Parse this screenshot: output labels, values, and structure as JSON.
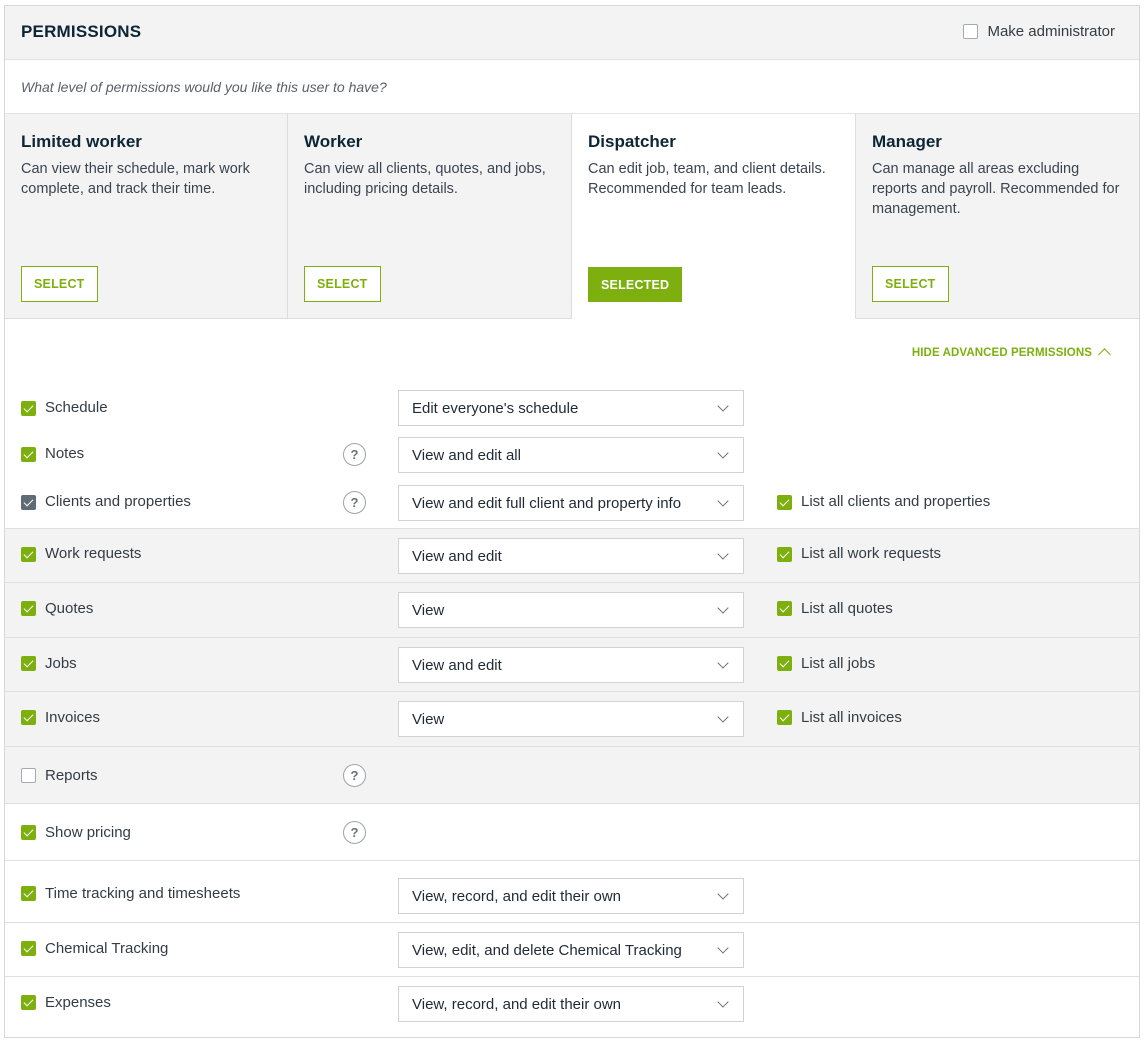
{
  "header": {
    "title": "PERMISSIONS",
    "admin_label": "Make administrator"
  },
  "question": "What level of permissions would you like this user to have?",
  "roles": [
    {
      "name": "Limited worker",
      "desc": "Can view their schedule, mark work complete, and track their time.",
      "button": "SELECT"
    },
    {
      "name": "Worker",
      "desc": "Can view all clients, quotes, and jobs, including pricing details.",
      "button": "SELECT"
    },
    {
      "name": "Dispatcher",
      "desc": "Can edit job, team, and client details. Recommended for team leads.",
      "button": "SELECTED"
    },
    {
      "name": "Manager",
      "desc": "Can manage all areas excluding reports and payroll. Recommended for management.",
      "button": "SELECT"
    }
  ],
  "advanced_toggle": "HIDE ADVANCED PERMISSIONS",
  "permissions": [
    {
      "label": "Schedule",
      "value": "Edit everyone's schedule"
    },
    {
      "label": "Notes",
      "help": "?",
      "value": "View and edit all"
    },
    {
      "label": "Clients and properties",
      "help": "?",
      "value": "View and edit full client and property info",
      "list": "List all clients and properties"
    },
    {
      "label": "Work requests",
      "value": "View and edit",
      "list": "List all work requests"
    },
    {
      "label": "Quotes",
      "value": "View",
      "list": "List all quotes"
    },
    {
      "label": "Jobs",
      "value": "View and edit",
      "list": "List all jobs"
    },
    {
      "label": "Invoices",
      "value": "View",
      "list": "List all invoices"
    },
    {
      "label": "Reports",
      "help": "?"
    },
    {
      "label": "Show pricing",
      "help": "?"
    },
    {
      "label": "Time tracking and timesheets",
      "value": "View, record, and edit their own"
    },
    {
      "label": "Chemical Tracking",
      "value": "View, edit, and delete Chemical Tracking"
    },
    {
      "label": "Expenses",
      "value": "View, record, and edit their own"
    }
  ],
  "colors": {
    "accent": "#7db00e",
    "header_bg": "#f3f3f3",
    "title": "#0d2636"
  }
}
